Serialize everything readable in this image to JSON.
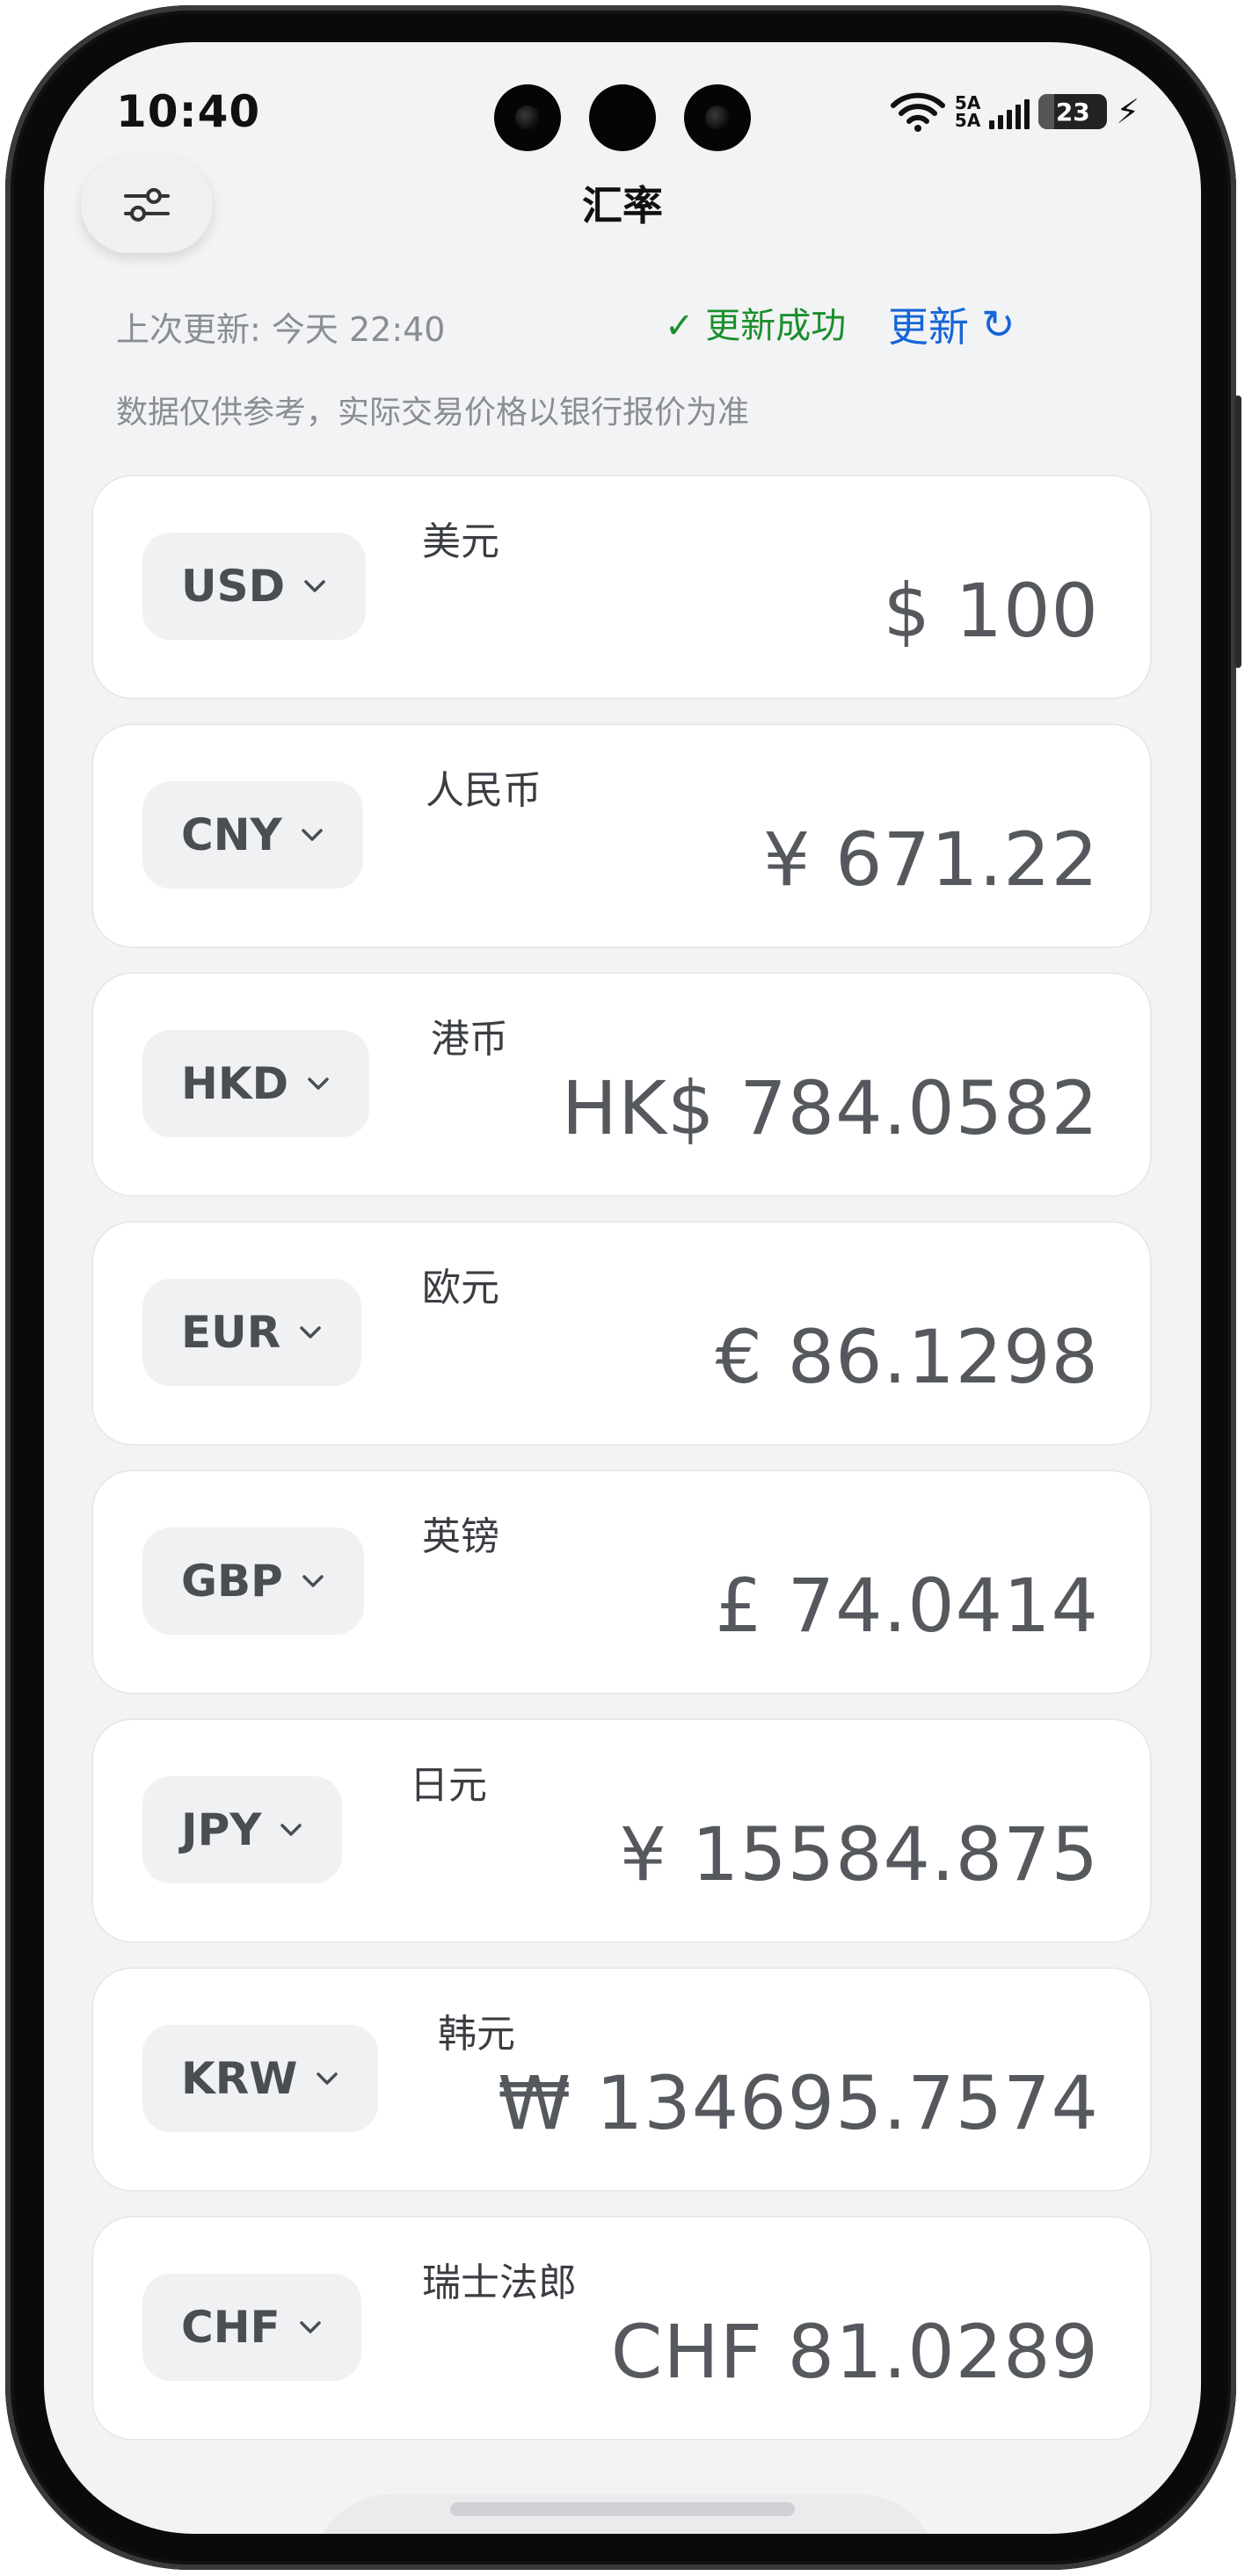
{
  "status_bar": {
    "time": "10:40",
    "signal_top": "5A",
    "signal_bottom": "5A",
    "battery": "23",
    "battery_level": 0.23,
    "icons": [
      "wifi-icon",
      "signal-bars-icon",
      "battery-icon",
      "charging-bolt-icon"
    ]
  },
  "header": {
    "title": "汇率",
    "filter_icon": "sliders-icon"
  },
  "update_info": {
    "last_update": "上次更新: 今天 22:40",
    "status": "✓ 更新成功",
    "status_color": "#1a8f2a",
    "refresh_label": "更新",
    "refresh_icon": "↻",
    "accent_color": "#1565d8",
    "disclaimer": "数据仅供参考，实际交易价格以银行报价为准"
  },
  "currencies": [
    {
      "code": "USD",
      "name": "美元",
      "amount": "$ 100"
    },
    {
      "code": "CNY",
      "name": "人民币",
      "amount": "¥ 671.22"
    },
    {
      "code": "HKD",
      "name": "港币",
      "amount": "HK$ 784.0582"
    },
    {
      "code": "EUR",
      "name": "欧元",
      "amount": "€ 86.1298"
    },
    {
      "code": "GBP",
      "name": "英镑",
      "amount": "£ 74.0414"
    },
    {
      "code": "JPY",
      "name": "日元",
      "amount": "¥ 15584.875"
    },
    {
      "code": "KRW",
      "name": "韩元",
      "amount": "₩ 134695.7574"
    },
    {
      "code": "CHF",
      "name": "瑞士法郎",
      "amount": "CHF 81.0289"
    }
  ]
}
